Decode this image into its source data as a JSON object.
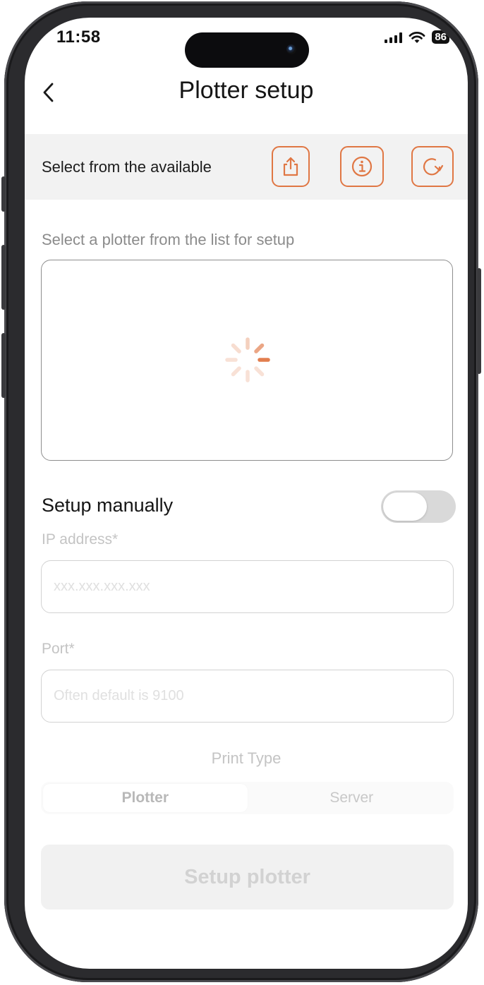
{
  "status_bar": {
    "time": "11:58",
    "battery": "86",
    "icons": [
      "signal-icon",
      "wifi-icon",
      "battery-icon"
    ]
  },
  "header": {
    "back_icon": "chevron-left-icon",
    "title": "Plotter setup"
  },
  "available": {
    "label": "Select from the available",
    "actions": [
      {
        "name": "share-button",
        "icon": "share-icon"
      },
      {
        "name": "info-button",
        "icon": "info-icon"
      },
      {
        "name": "refresh-button",
        "icon": "refresh-icon"
      }
    ]
  },
  "plotter_list": {
    "hint": "Select a plotter from the list for setup",
    "loading_icon": "spinner-icon"
  },
  "manual": {
    "label": "Setup manually",
    "enabled": false
  },
  "ip_field": {
    "label": "IP address*",
    "value": "",
    "placeholder": "xxx.xxx.xxx.xxx"
  },
  "port_field": {
    "label": "Port*",
    "value": "",
    "placeholder": "Often default is 9100"
  },
  "print_type": {
    "label": "Print Type",
    "options": [
      "Plotter",
      "Server"
    ],
    "selected": "Plotter"
  },
  "submit": {
    "label": "Setup plotter"
  },
  "colors": {
    "accent": "#E07744",
    "toggle_off": "#D9D9D9",
    "disabled_button_bg": "#F1F1F1"
  }
}
